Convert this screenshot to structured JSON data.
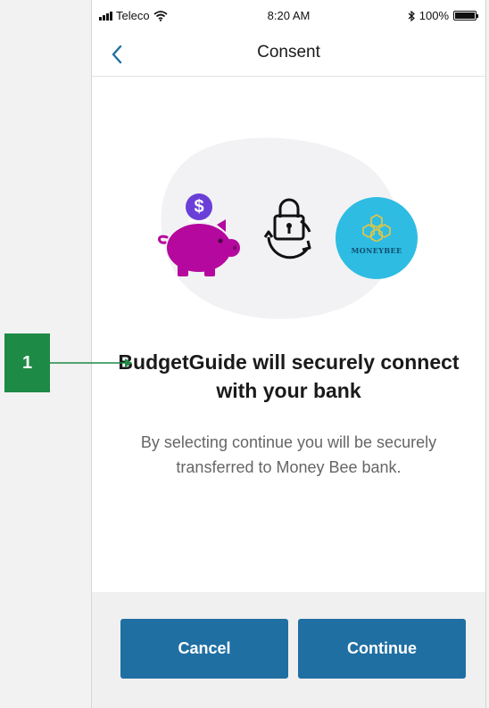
{
  "status_bar": {
    "carrier": "Teleco",
    "time": "8:20 AM",
    "battery": "100%"
  },
  "nav": {
    "title": "Consent"
  },
  "hero": {
    "piggy_symbol": "$",
    "bank_logo_text": "MONEYBEE"
  },
  "content": {
    "headline": "BudgetGuide will securely connect with your bank",
    "body": "By selecting continue you will be securely transferred to Money Bee bank."
  },
  "actions": {
    "cancel_label": "Cancel",
    "continue_label": "Continue"
  },
  "annotation": {
    "number": "1"
  },
  "colors": {
    "primary_button": "#1f6fa3",
    "piggy": "#b5089e",
    "coin": "#6a3fd8",
    "bank_circle": "#2ebce3",
    "annotation": "#1d8a45"
  },
  "icons": [
    "wifi-icon",
    "bluetooth-icon",
    "battery-icon",
    "back-chevron-icon",
    "piggy-bank-icon",
    "lock-sync-icon",
    "moneybee-logo"
  ]
}
